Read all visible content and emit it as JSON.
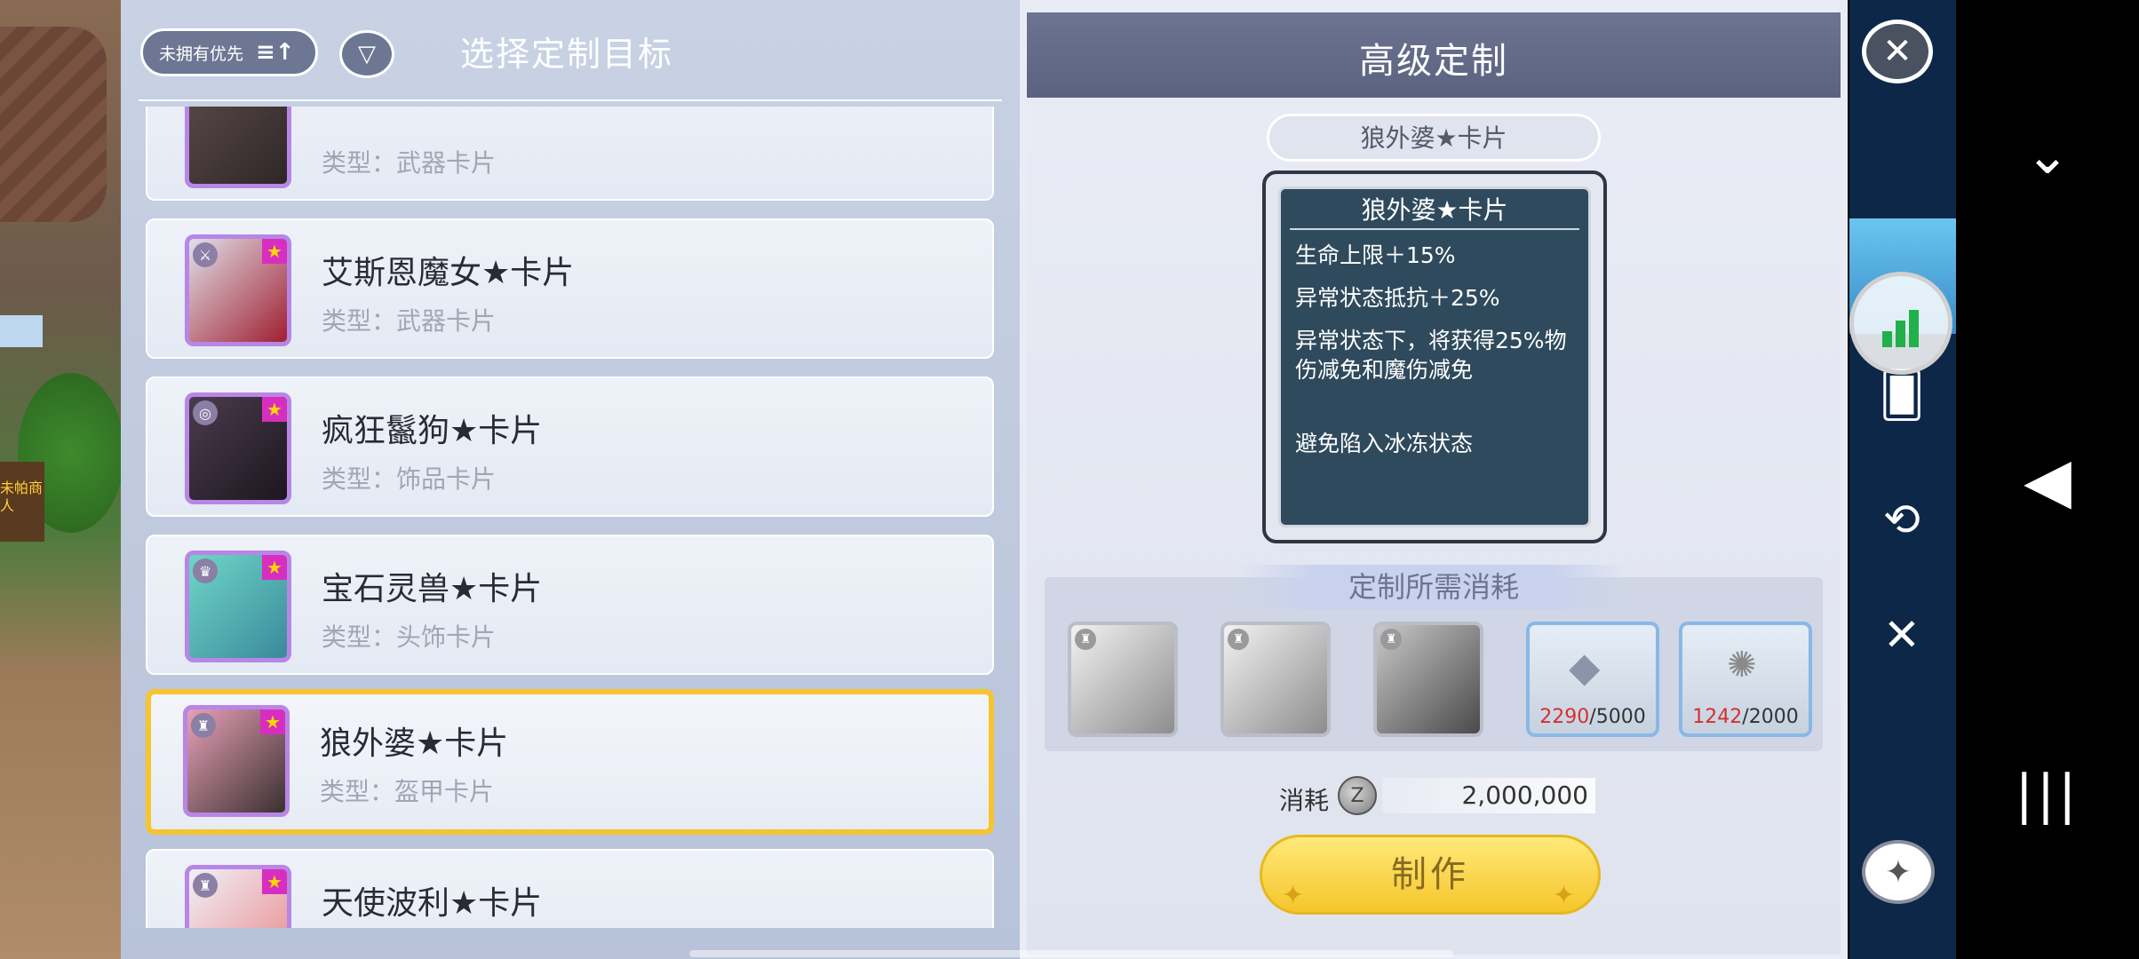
{
  "header": {
    "sort_label": "未拥有优先",
    "title": "选择定制目标"
  },
  "items": [
    {
      "name": "",
      "type": "类型：武器卡片"
    },
    {
      "name": "艾斯恩魔女★卡片",
      "type": "类型：武器卡片"
    },
    {
      "name": "疯狂鬣狗★卡片",
      "type": "类型：饰品卡片"
    },
    {
      "name": "宝石灵兽★卡片",
      "type": "类型：头饰卡片"
    },
    {
      "name": "狼外婆★卡片",
      "type": "类型：盔甲卡片",
      "selected": true
    },
    {
      "name": "天使波利★卡片",
      "type": ""
    }
  ],
  "detail": {
    "panel_title": "高级定制",
    "card_name": "狼外婆★卡片",
    "card_title": "狼外婆★卡片",
    "effects": [
      "生命上限＋15%",
      "异常状态抵抗＋25%",
      "异常状态下，将获得25%物伤减免和魔伤减免",
      "避免陷入冰冻状态"
    ],
    "cost_title": "定制所需消耗",
    "materials": [
      {
        "have": "2290",
        "need": "/5000"
      },
      {
        "have": "1242",
        "need": "/2000"
      }
    ],
    "zeny_label": "消耗",
    "zeny_value": "2,000,000",
    "make_label": "制作"
  },
  "side_text": "未帕商人",
  "colors": {
    "selected_border": "#f5c430",
    "avatar_border": "#b786e6",
    "shortage_red": "#d63030",
    "make_button": "#f5c62a"
  }
}
